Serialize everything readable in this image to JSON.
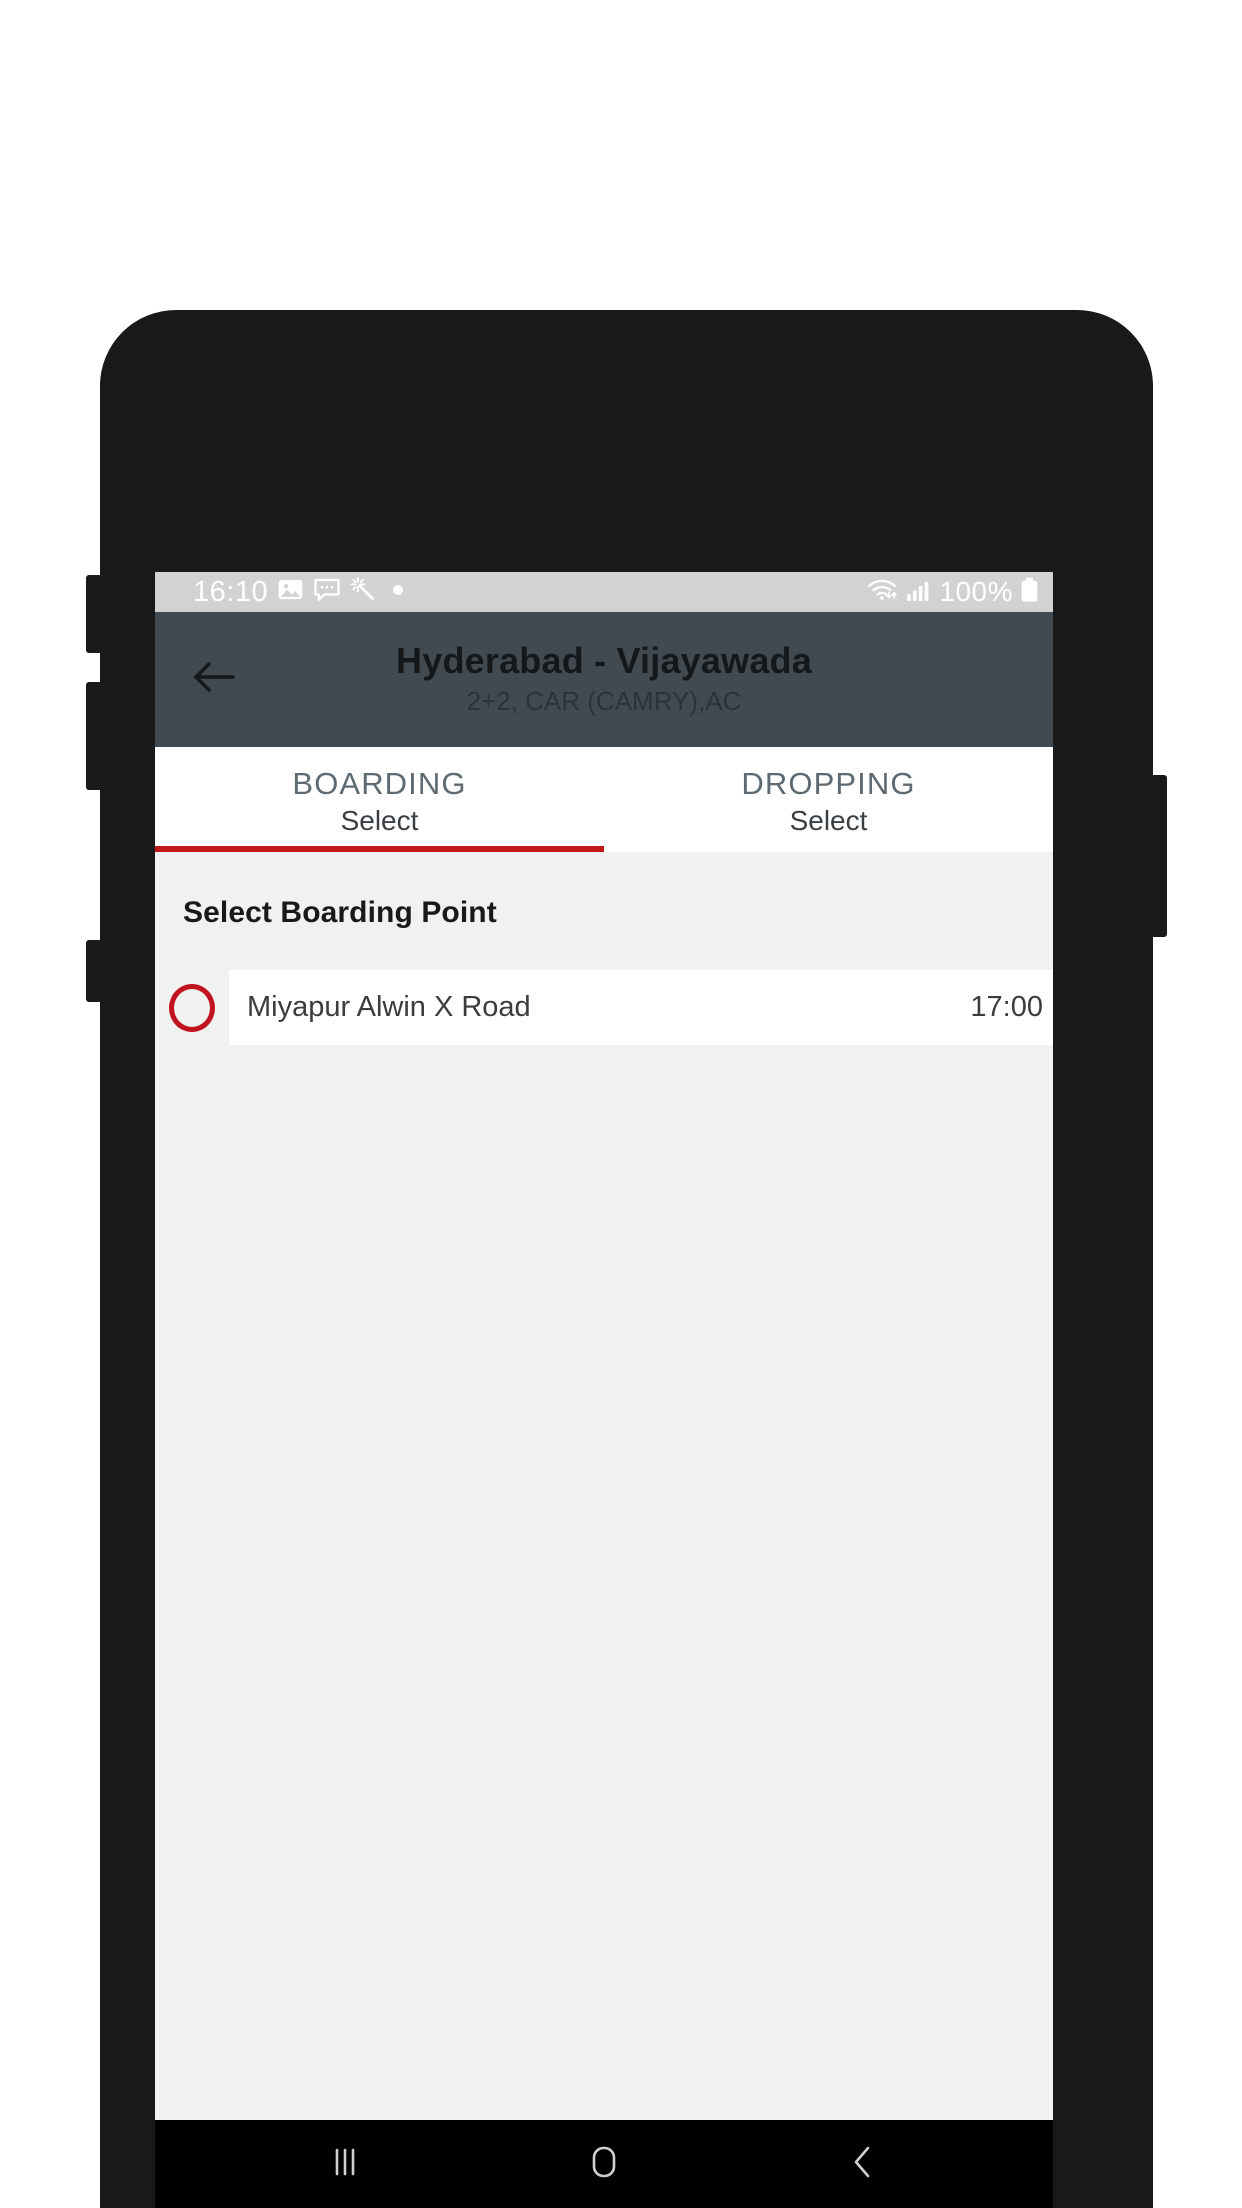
{
  "device": {
    "frame_color": "#191919",
    "buttons": [
      {
        "name": "silent-switch"
      },
      {
        "name": "volume-up"
      },
      {
        "name": "volume-down"
      },
      {
        "name": "power"
      }
    ]
  },
  "status_bar": {
    "background": "#d4d2d1",
    "clock": "16:10",
    "left_icons": [
      "image-icon",
      "message-icon",
      "magic-wand-icon",
      "dot-icon"
    ],
    "right_icons": [
      "wifi-icon",
      "cellular-signal-icon"
    ],
    "battery_text": "100%",
    "battery_icon": "battery-full-icon"
  },
  "app_bar": {
    "background": "#414a51",
    "back_icon": "arrow-left-icon",
    "title": "Hyderabad - Vijayawada",
    "subtitle": "2+2, CAR (CAMRY),AC"
  },
  "tabs": {
    "active_index": 0,
    "indicator_color": "#c31818",
    "items": [
      {
        "title": "BOARDING",
        "subtitle": "Select"
      },
      {
        "title": "DROPPING",
        "subtitle": "Select"
      }
    ]
  },
  "content": {
    "section_heading": "Select Boarding Point",
    "points": [
      {
        "name": "Miyapur Alwin X Road",
        "time": "17:00",
        "selected": false
      }
    ],
    "radio_color": "#c1121f"
  },
  "nav_bar": {
    "background": "#000000",
    "buttons": [
      {
        "icon": "recents-icon"
      },
      {
        "icon": "home-icon"
      },
      {
        "icon": "back-icon"
      }
    ]
  }
}
